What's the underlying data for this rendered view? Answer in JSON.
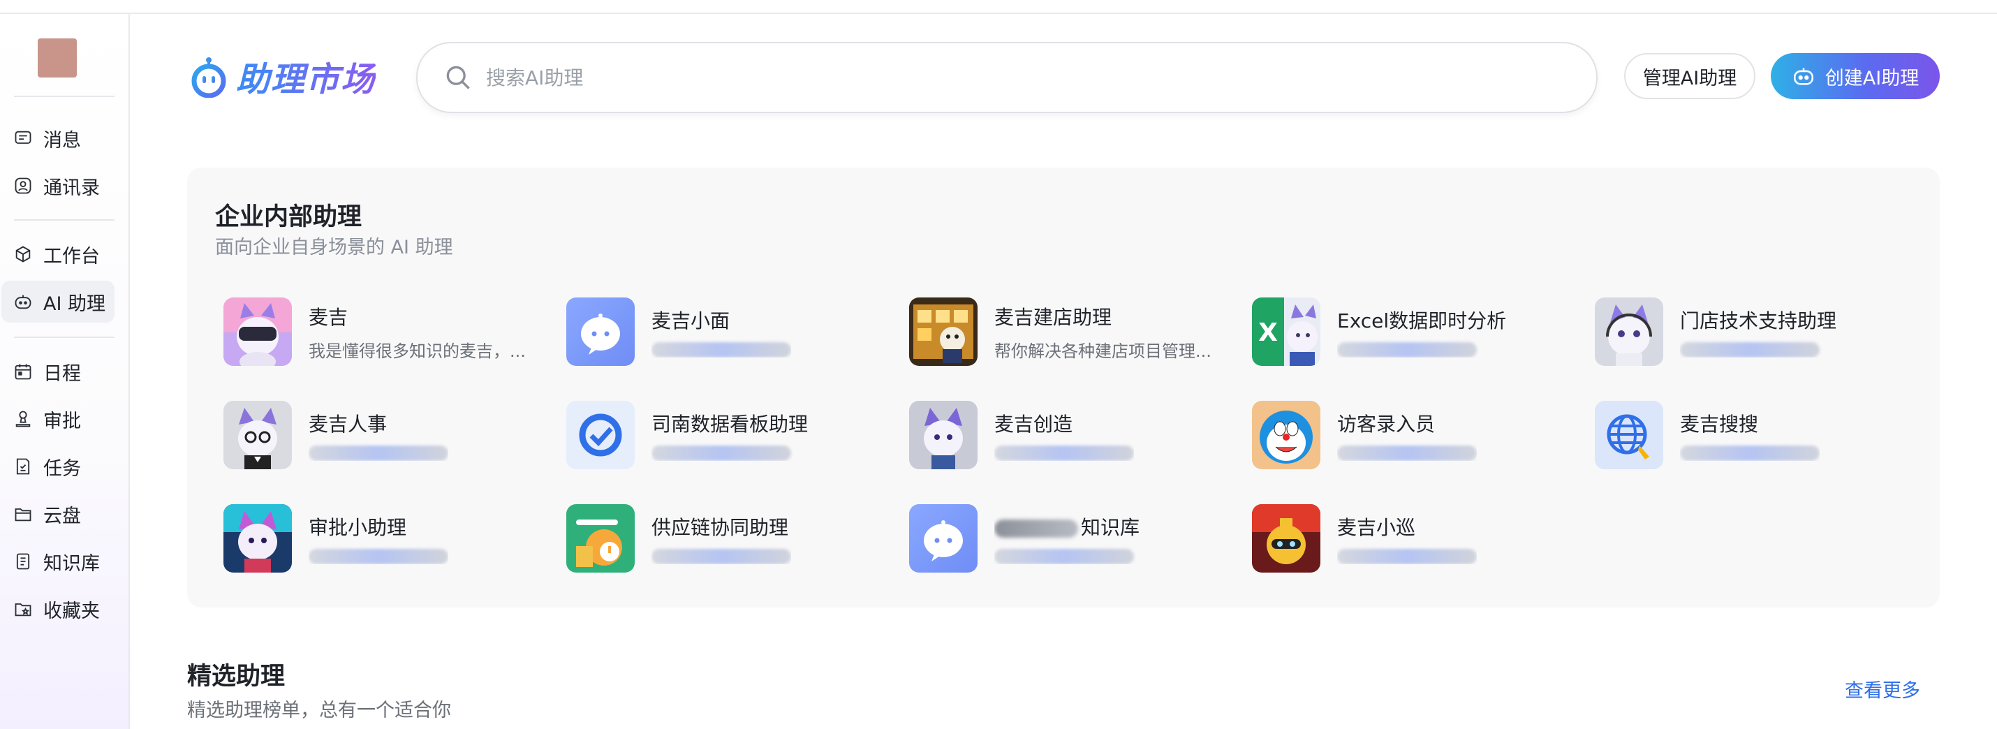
{
  "sidebar": {
    "items": [
      {
        "label": "消息",
        "icon": "message-icon"
      },
      {
        "label": "通讯录",
        "icon": "contacts-icon"
      },
      {
        "label": "工作台",
        "icon": "workspace-icon"
      },
      {
        "label": "AI 助理",
        "icon": "ai-bot-icon",
        "active": true
      },
      {
        "label": "日程",
        "icon": "calendar-icon"
      },
      {
        "label": "审批",
        "icon": "approval-icon"
      },
      {
        "label": "任务",
        "icon": "task-icon"
      },
      {
        "label": "云盘",
        "icon": "folder-icon"
      },
      {
        "label": "知识库",
        "icon": "book-icon"
      },
      {
        "label": "收藏夹",
        "icon": "favorites-icon"
      }
    ]
  },
  "header": {
    "logo_text": "助理市场",
    "search_placeholder": "搜索AI助理",
    "manage_label": "管理AI助理",
    "create_label": "创建AI助理"
  },
  "internal": {
    "title": "企业内部助理",
    "subtitle": "面向企业自身场景的 AI 助理",
    "assistants": [
      {
        "name": "麦吉",
        "desc": "我是懂得很多知识的麦吉，..."
      },
      {
        "name": "麦吉小面",
        "desc": ""
      },
      {
        "name": "麦吉建店助理",
        "desc": "帮你解决各种建店项目管理..."
      },
      {
        "name": "Excel数据即时分析",
        "desc": ""
      },
      {
        "name": "门店技术支持助理",
        "desc": ""
      },
      {
        "name": "麦吉人事",
        "desc": ""
      },
      {
        "name": "司南数据看板助理",
        "desc": ""
      },
      {
        "name": "麦吉创造",
        "desc": ""
      },
      {
        "name": "访客录入员",
        "desc": ""
      },
      {
        "name": "麦吉搜搜",
        "desc": ""
      },
      {
        "name": "审批小助理",
        "desc": ""
      },
      {
        "name": "供应链协同助理",
        "desc": ""
      },
      {
        "name": "知识库",
        "desc": ""
      },
      {
        "name": "麦吉小巡",
        "desc": ""
      }
    ]
  },
  "featured": {
    "title": "精选助理",
    "subtitle": "精选助理榜单，总有一个适合你",
    "see_more": "查看更多"
  },
  "colors": {
    "accent": "#5a6cf0",
    "link": "#2f6fe8",
    "create_gradient": [
      "#2fb0e6",
      "#7b55ea"
    ]
  }
}
